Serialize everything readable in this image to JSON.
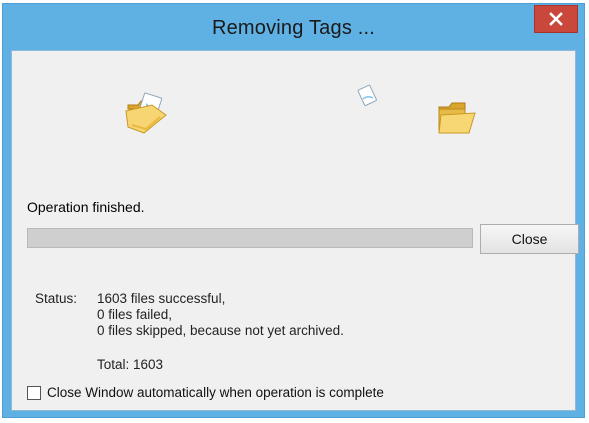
{
  "window": {
    "title": "Removing Tags ..."
  },
  "animation": {
    "source_icon": "folder-open-icon",
    "flying_icon": "document-icon",
    "target_icon": "folder-icon"
  },
  "operation": {
    "message": "Operation finished.",
    "progress_fraction": 0
  },
  "buttons": {
    "close_label": "Close"
  },
  "status": {
    "label": "Status:",
    "lines": [
      "1603 files successful,",
      "0 files failed,",
      "0 files skipped, because not yet archived."
    ],
    "total": "Total: 1603"
  },
  "options": {
    "auto_close_label": "Close Window automatically when operation is complete",
    "auto_close_checked": false
  },
  "colors": {
    "titlebar": "#5fb0e3",
    "close_button": "#c9483b",
    "client_bg": "#f0f0f0"
  }
}
